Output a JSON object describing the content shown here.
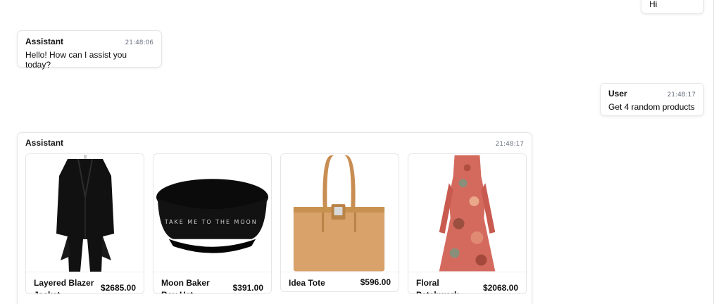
{
  "messages": [
    {
      "role_label": "",
      "time": "",
      "text": "Hi"
    },
    {
      "role_label": "Assistant",
      "time": "21:48:06",
      "text": "Hello! How can I assist you today?"
    },
    {
      "role_label": "User",
      "time": "21:48:17",
      "text": "Get 4 random products"
    },
    {
      "role_label": "Assistant",
      "time": "21:48:17"
    }
  ],
  "products": [
    {
      "name": "Layered Blazer Jacket",
      "price": "$2685.00",
      "image_icon": "blazer-image"
    },
    {
      "name": "Moon Baker Boy Hat",
      "price": "$391.00",
      "image_icon": "hat-image",
      "hat_text": "TAKE ME TO THE MOON"
    },
    {
      "name": "Idea Tote",
      "price": "$596.00",
      "image_icon": "tote-image"
    },
    {
      "name": "Floral Patchwork...",
      "price": "$2068.00",
      "image_icon": "dress-image"
    }
  ],
  "colors": {
    "border": "#e3e5e8",
    "text": "#111111",
    "muted": "#6b7280",
    "tote": "#d9a26a",
    "dress": "#d46a5e"
  }
}
